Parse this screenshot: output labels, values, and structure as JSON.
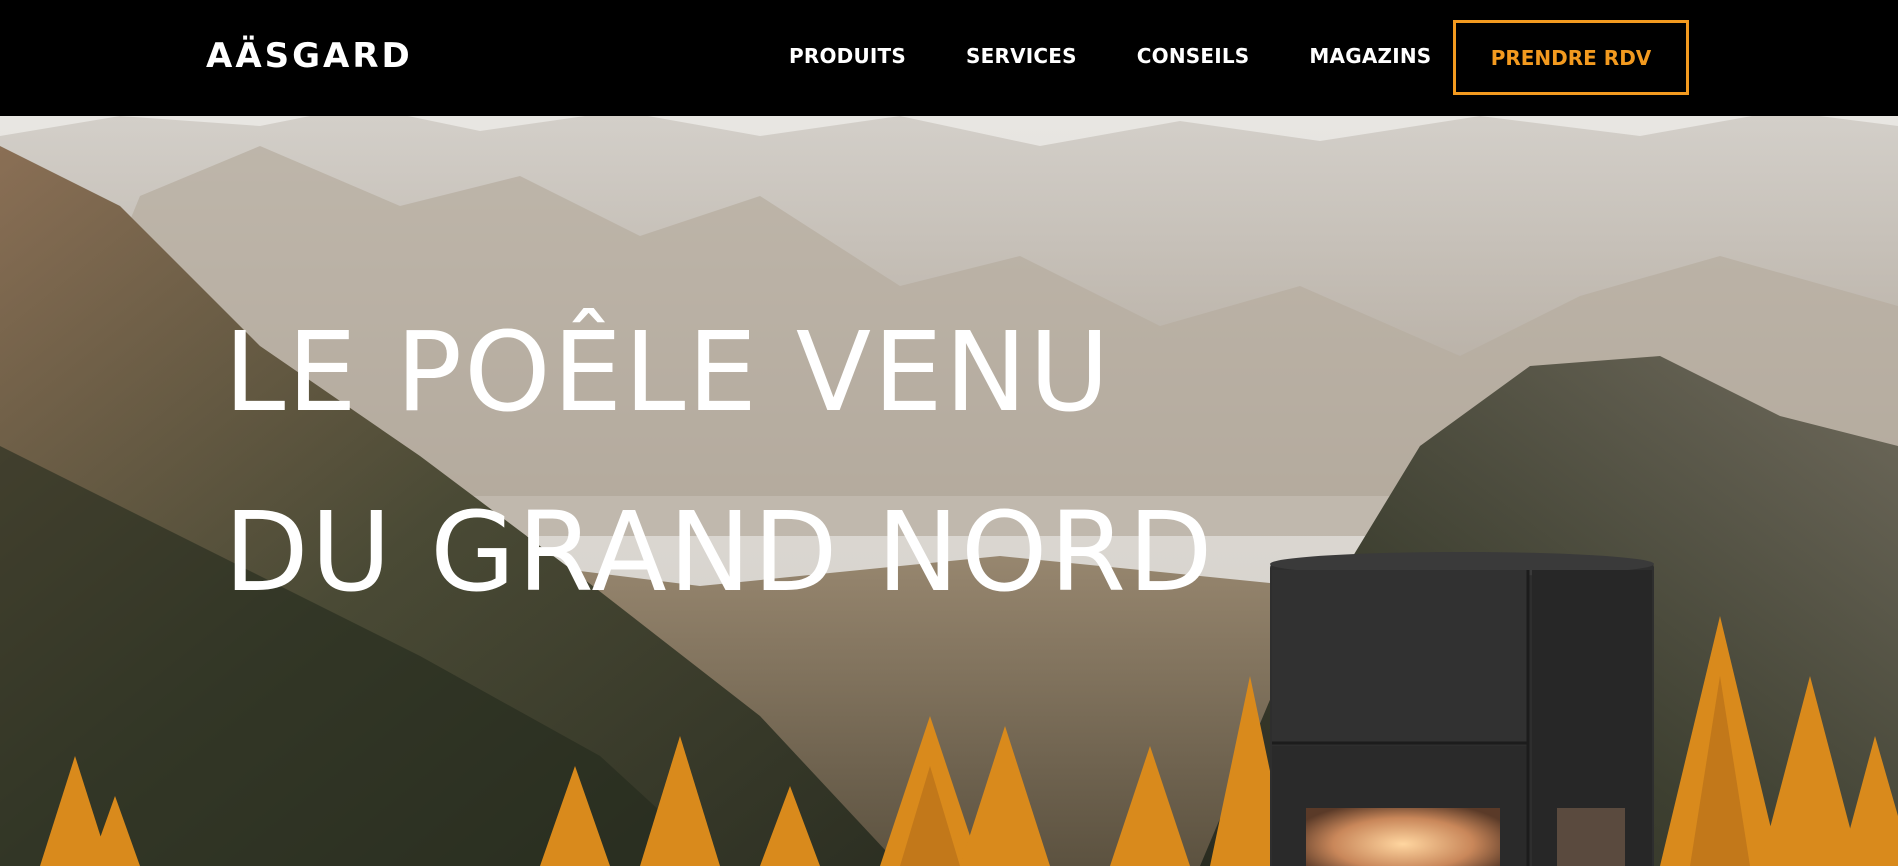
{
  "header": {
    "logo": "AÄSGARD",
    "nav": [
      {
        "label": "PRODUITS"
      },
      {
        "label": "SERVICES"
      },
      {
        "label": "CONSEILS"
      },
      {
        "label": "MAGAZINS"
      }
    ],
    "cta_label": "PRENDRE RDV"
  },
  "hero": {
    "headline_line1": "LE POÊLE VENU",
    "headline_line2": "DU GRAND NORD"
  },
  "colors": {
    "accent": "#f39a1f",
    "header_bg": "#000000",
    "text_light": "#ffffff"
  }
}
